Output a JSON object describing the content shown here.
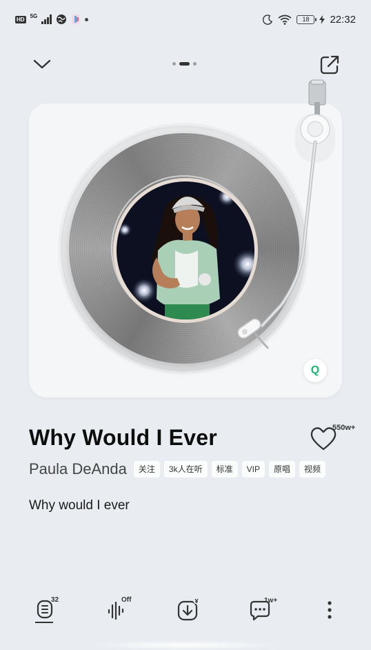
{
  "status_bar": {
    "hd": "HD",
    "network": "5G",
    "battery": "18",
    "time": "22:32"
  },
  "song": {
    "title": "Why Would I Ever",
    "artist": "Paula DeAnda",
    "like_count": "550w+",
    "lyric": "Why would I ever"
  },
  "tags": [
    "关注",
    "3k人在听",
    "标准",
    "VIP",
    "原唱",
    "视频"
  ],
  "toolbar": {
    "playlist_count": "32",
    "effect_state": "Off",
    "comment_count": "1w+"
  },
  "badge": {
    "label": "Q"
  },
  "colors": {
    "background": "#e9edf1",
    "accent_green": "#17b673"
  }
}
